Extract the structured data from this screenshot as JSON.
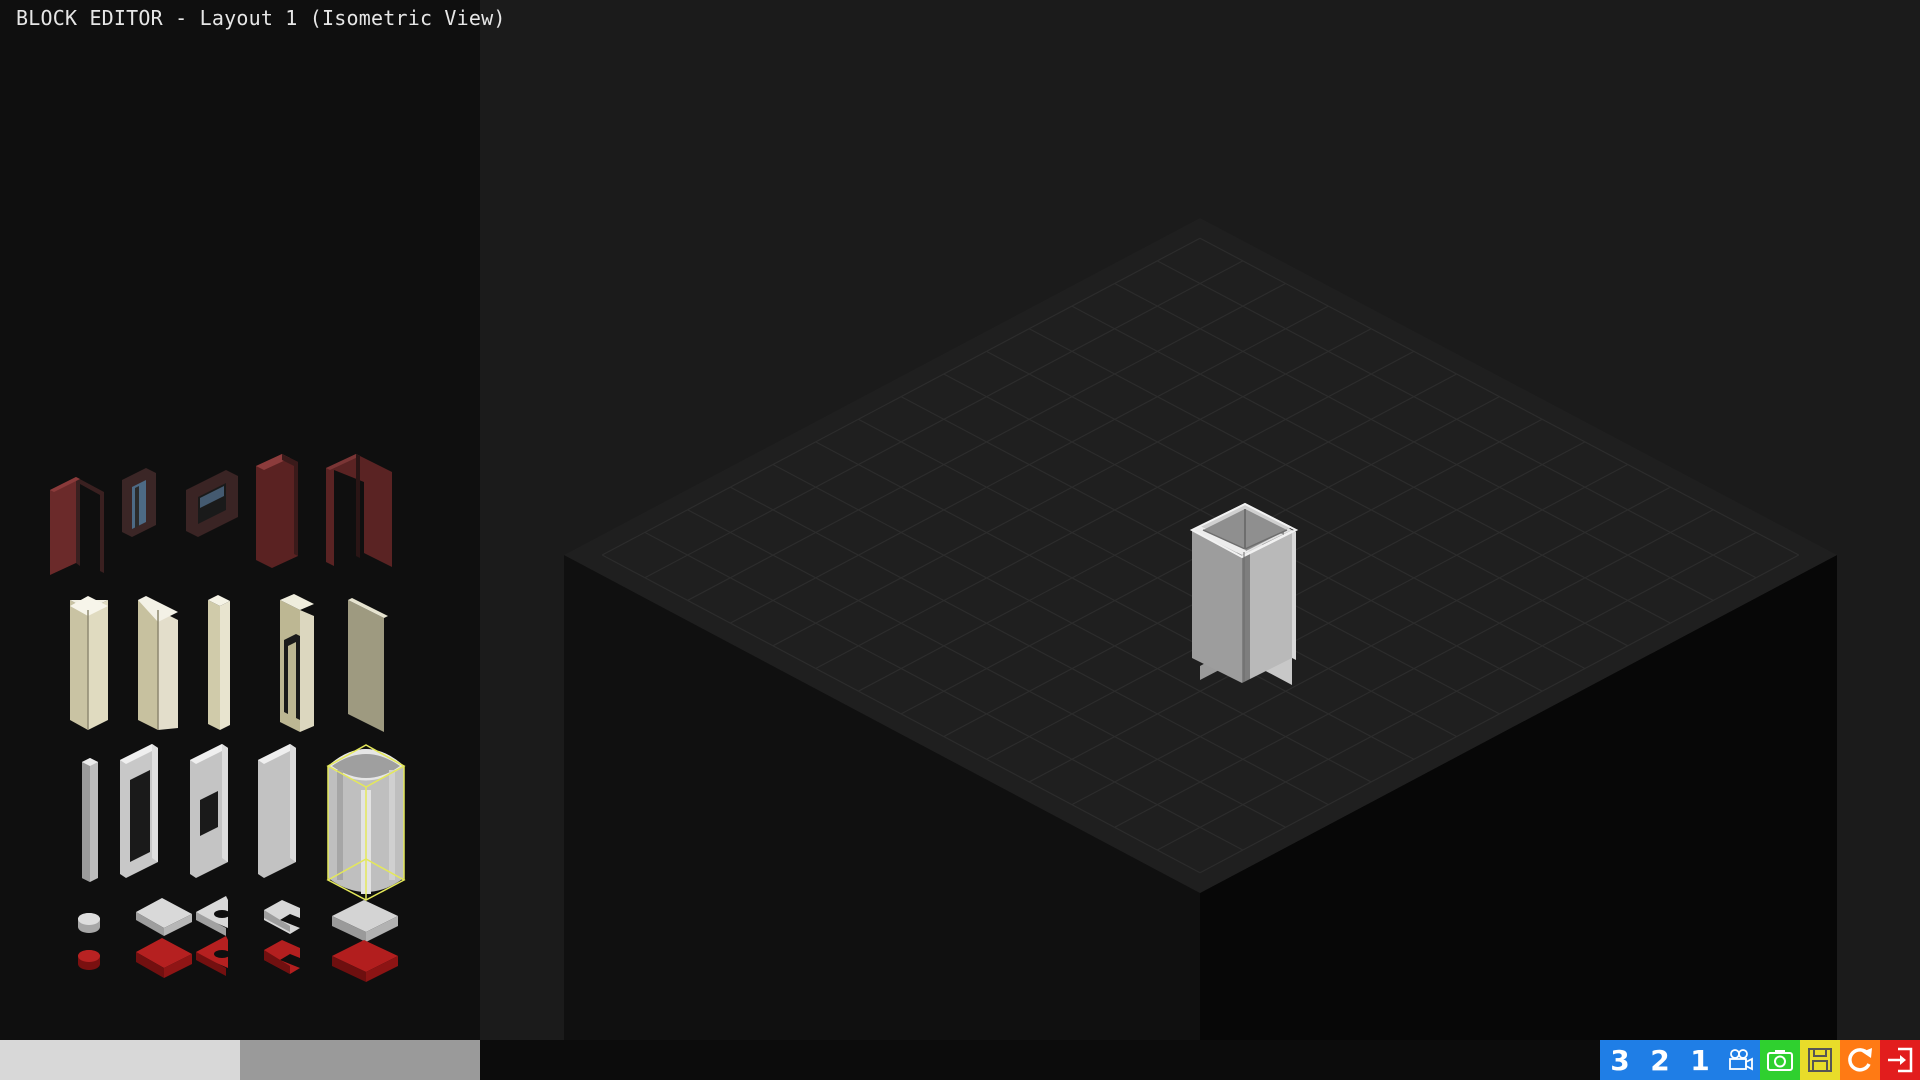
{
  "title": "BLOCK EDITOR - Layout 1 (Isometric View)",
  "toolbar": {
    "layer3_label": "3",
    "layer2_label": "2",
    "layer1_label": "1",
    "colors": {
      "layer": "#1f7ee6",
      "camera": "#1f7ee6",
      "screenshot": "#2fd02f",
      "save": "#e8dc2a",
      "reset": "#ff7a14",
      "exit": "#e21d1d"
    },
    "icons": [
      "camera-icon",
      "screenshot-icon",
      "save-icon",
      "reset-icon",
      "exit-icon"
    ]
  },
  "palette": {
    "rows": [
      {
        "group": "doors-windows",
        "items": [
          "door-open-dark",
          "window-small",
          "window-frame",
          "door-closed-dark",
          "door-open-dark-2"
        ]
      },
      {
        "group": "walls-beige",
        "items": [
          "wall-cross",
          "wall-corner",
          "wall-thin",
          "wall-doorway",
          "wall-flat"
        ]
      },
      {
        "group": "walls-white",
        "items": [
          "pillar",
          "wall-window-large",
          "wall-window-small",
          "wall-panel",
          "wall-rounded-selected"
        ]
      },
      {
        "group": "floors",
        "items": [
          "floor-round",
          "floor-square",
          "floor-cutout",
          "floor-l-shape",
          "floor-tile"
        ]
      }
    ],
    "selected": "wall-rounded-selected"
  },
  "scene": {
    "grid_cells": 14,
    "placed_block": "wall-corner-white"
  }
}
